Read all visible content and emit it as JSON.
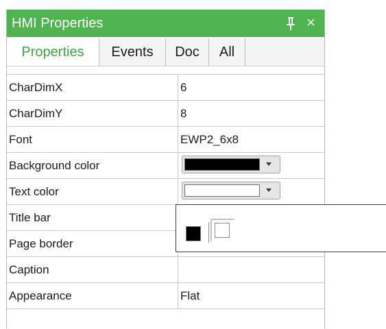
{
  "panel": {
    "title": "HMI Properties",
    "pin_icon": "pin-icon",
    "close_glyph": "×",
    "accent_color": "#4fb34f"
  },
  "tabs": [
    {
      "label": "Properties",
      "active": true
    },
    {
      "label": "Events",
      "active": false
    },
    {
      "label": "Doc",
      "active": false
    },
    {
      "label": "All",
      "active": false
    }
  ],
  "properties": [
    {
      "name": "CharDimX",
      "value": "6"
    },
    {
      "name": "CharDimY",
      "value": "8"
    },
    {
      "name": "Font",
      "value": "EWP2_6x8"
    },
    {
      "name": "Background color",
      "value": "",
      "color": "#000000"
    },
    {
      "name": "Text color",
      "value": "",
      "color": "#ffffff"
    },
    {
      "name": "Title bar",
      "value": ""
    },
    {
      "name": "Page border",
      "value": ""
    },
    {
      "name": "Caption",
      "value": ""
    },
    {
      "name": "Appearance",
      "value": "Flat"
    }
  ],
  "color_popup": {
    "options": [
      "#000000",
      "#ffffff"
    ]
  }
}
